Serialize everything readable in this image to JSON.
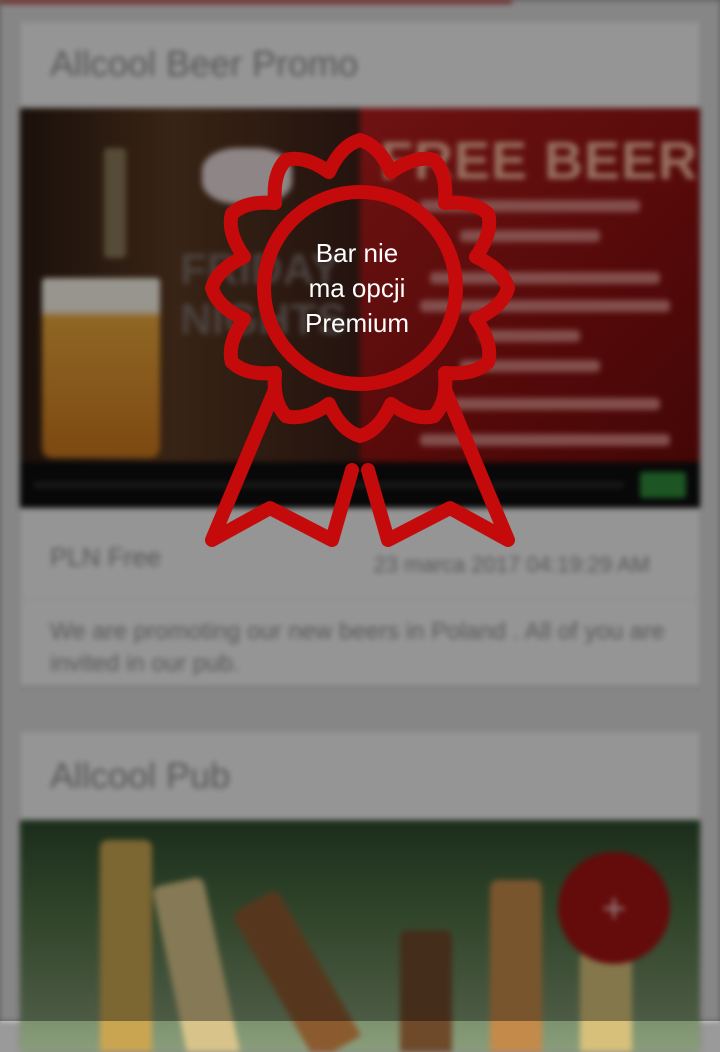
{
  "cards": [
    {
      "title": "Allcool Beer Promo",
      "image": {
        "headline": "FREE BEER",
        "text_left_1": "FRIDAY",
        "text_left_2": "NIGHTS"
      },
      "price": "PLN Free",
      "date": "23 marca 2017 04:19:29 AM",
      "description": "We are promoting our new beers in Poland . All of you are invited in our pub."
    },
    {
      "title": "Allcool Pub"
    }
  ],
  "fab": {
    "label": "+"
  },
  "premium_badge": {
    "text_line1": "Bar nie",
    "text_line2": "ma opcji",
    "text_line3": "Premium",
    "color": "#c40a0a",
    "icon": "award-ribbon-icon"
  },
  "colors": {
    "accent": "#c23b3b",
    "overlay": "rgba(0,0,0,0.38)",
    "fab": "#a21212"
  }
}
